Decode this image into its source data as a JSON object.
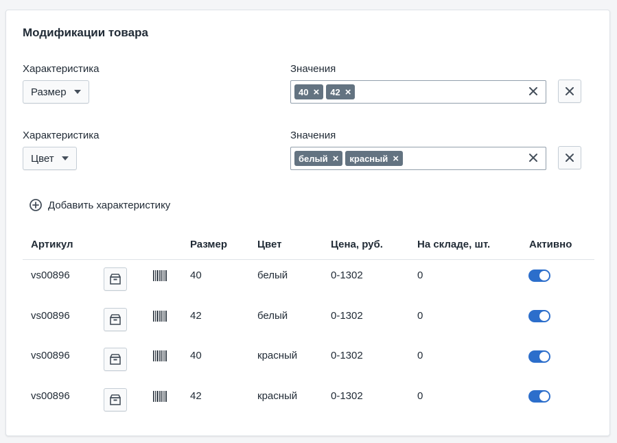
{
  "card": {
    "title": "Модификации товара"
  },
  "options": [
    {
      "characteristic_label": "Характеристика",
      "characteristic_value": "Размер",
      "values_label": "Значения",
      "tags": [
        "40",
        "42"
      ]
    },
    {
      "characteristic_label": "Характеристика",
      "characteristic_value": "Цвет",
      "values_label": "Значения",
      "tags": [
        "белый",
        "красный"
      ]
    }
  ],
  "add_characteristic_label": "Добавить характеристику",
  "table": {
    "headers": {
      "sku": "Артикул",
      "size": "Размер",
      "color": "Цвет",
      "price": "Цена, руб.",
      "stock": "На складе, шт.",
      "active": "Активно"
    },
    "rows": [
      {
        "sku": "vs00896",
        "size": "40",
        "color": "белый",
        "price": "0-1302",
        "stock": "0",
        "active": true
      },
      {
        "sku": "vs00896",
        "size": "42",
        "color": "белый",
        "price": "0-1302",
        "stock": "0",
        "active": true
      },
      {
        "sku": "vs00896",
        "size": "40",
        "color": "красный",
        "price": "0-1302",
        "stock": "0",
        "active": true
      },
      {
        "sku": "vs00896",
        "size": "42",
        "color": "красный",
        "price": "0-1302",
        "stock": "0",
        "active": true
      }
    ]
  },
  "icons": {
    "tag_remove": "close-icon",
    "clear_values": "close-icon",
    "remove_option": "close-icon",
    "add": "plus-circle-icon",
    "box": "archive-box-icon",
    "barcode": "barcode-icon"
  },
  "colors": {
    "tag_bg": "#637381",
    "toggle_on": "#2c6ecb"
  }
}
